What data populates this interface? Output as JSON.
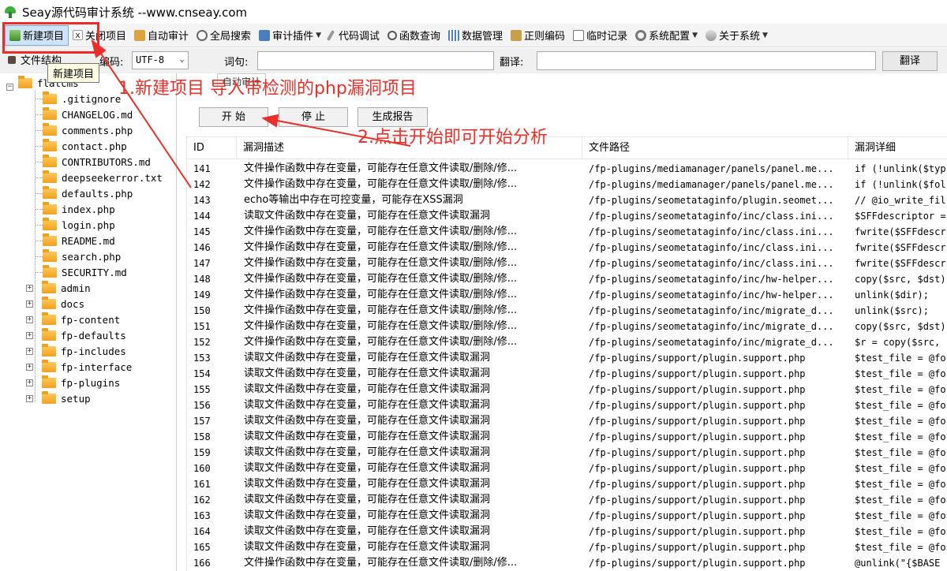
{
  "app": {
    "title": "Seay源代码审计系统  --www.cnseay.com"
  },
  "toolbar": {
    "items": [
      {
        "label": "新建项目",
        "icon": "new-project-icon"
      },
      {
        "label": "关闭项目",
        "icon": "close-project-icon"
      },
      {
        "label": "自动审计",
        "icon": "auto-audit-icon"
      },
      {
        "label": "全局搜索",
        "icon": "global-search-icon"
      },
      {
        "label": "审计插件",
        "icon": "audit-plugin-icon"
      },
      {
        "label": "代码调试",
        "icon": "code-debug-icon"
      },
      {
        "label": "函数查询",
        "icon": "function-query-icon"
      },
      {
        "label": "数据管理",
        "icon": "data-manage-icon"
      },
      {
        "label": "正则编码",
        "icon": "regex-encode-icon"
      },
      {
        "label": "临时记录",
        "icon": "temp-record-icon"
      },
      {
        "label": "系统配置",
        "icon": "system-config-icon"
      },
      {
        "label": "关于系统",
        "icon": "about-system-icon"
      }
    ]
  },
  "row2": {
    "file_tab": "文件结构",
    "encoding_label": "编码:",
    "encoding_value": "UTF-8",
    "word_label": "词句:",
    "translate_label": "翻译:",
    "translate_button": "翻译"
  },
  "tooltip": "新建项目",
  "tree": {
    "root": "flatcms",
    "files": [
      ".gitignore",
      "CHANGELOG.md",
      "comments.php",
      "contact.php",
      "CONTRIBUTORS.md",
      "deepseekerror.txt",
      "defaults.php",
      "index.php",
      "login.php",
      "README.md",
      "search.php",
      "SECURITY.md"
    ],
    "folders": [
      "admin",
      "docs",
      "fp-content",
      "fp-defaults",
      "fp-includes",
      "fp-interface",
      "fp-plugins",
      "setup"
    ]
  },
  "tabs": {
    "audit": "自动审计"
  },
  "buttons": {
    "start": "开 始",
    "stop": "停 止",
    "report": "生成报告"
  },
  "table": {
    "headers": [
      "ID",
      "漏洞描述",
      "文件路径",
      "漏洞详细"
    ],
    "rows": [
      [
        "141",
        "文件操作函数中存在变量，可能存在任意文件读取/删除/修...",
        "/fp-plugins/mediamanager/panels/panel.me...",
        "if (!unlink($typ"
      ],
      [
        "142",
        "文件操作函数中存在变量，可能存在任意文件读取/删除/修...",
        "/fp-plugins/mediamanager/panels/panel.me...",
        "if (!unlink($fol"
      ],
      [
        "143",
        "echo等输出中存在可控变量，可能存在XSS漏洞",
        "/fp-plugins/seometataginfo/plugin.seomet...",
        "// @io_write_fil"
      ],
      [
        "144",
        "读取文件函数中存在变量，可能存在任意文件读取漏洞",
        "/fp-plugins/seometataginfo/inc/class.ini...",
        "$SFFdescriptor ="
      ],
      [
        "145",
        "文件操作函数中存在变量，可能存在任意文件读取/删除/修...",
        "/fp-plugins/seometataginfo/inc/class.ini...",
        "fwrite($SFFdescr"
      ],
      [
        "146",
        "文件操作函数中存在变量，可能存在任意文件读取/删除/修...",
        "/fp-plugins/seometataginfo/inc/class.ini...",
        "fwrite($SFFdescr"
      ],
      [
        "147",
        "文件操作函数中存在变量，可能存在任意文件读取/删除/修...",
        "/fp-plugins/seometataginfo/inc/class.ini...",
        "fwrite($SFFdescr"
      ],
      [
        "148",
        "文件操作函数中存在变量，可能存在任意文件读取/删除/修...",
        "/fp-plugins/seometataginfo/inc/hw-helper...",
        "copy($src, $dst)"
      ],
      [
        "149",
        "文件操作函数中存在变量，可能存在任意文件读取/删除/修...",
        "/fp-plugins/seometataginfo/inc/hw-helper...",
        "unlink($dir);"
      ],
      [
        "150",
        "文件操作函数中存在变量，可能存在任意文件读取/删除/修...",
        "/fp-plugins/seometataginfo/inc/migrate_d...",
        "unlink($src);"
      ],
      [
        "151",
        "文件操作函数中存在变量，可能存在任意文件读取/删除/修...",
        "/fp-plugins/seometataginfo/inc/migrate_d...",
        "copy($src, $dst)"
      ],
      [
        "152",
        "文件操作函数中存在变量，可能存在任意文件读取/删除/修...",
        "/fp-plugins/seometataginfo/inc/migrate_d...",
        "$r = copy($src,"
      ],
      [
        "153",
        "读取文件函数中存在变量，可能存在任意文件读取漏洞",
        "/fp-plugins/support/plugin.support.php",
        "$test_file = @fo"
      ],
      [
        "154",
        "读取文件函数中存在变量，可能存在任意文件读取漏洞",
        "/fp-plugins/support/plugin.support.php",
        "$test_file = @fo"
      ],
      [
        "155",
        "读取文件函数中存在变量，可能存在任意文件读取漏洞",
        "/fp-plugins/support/plugin.support.php",
        "$test_file = @fo"
      ],
      [
        "156",
        "读取文件函数中存在变量，可能存在任意文件读取漏洞",
        "/fp-plugins/support/plugin.support.php",
        "$test_file = @fo"
      ],
      [
        "157",
        "读取文件函数中存在变量，可能存在任意文件读取漏洞",
        "/fp-plugins/support/plugin.support.php",
        "$test_file = @fo"
      ],
      [
        "158",
        "读取文件函数中存在变量，可能存在任意文件读取漏洞",
        "/fp-plugins/support/plugin.support.php",
        "$test_file = @fo"
      ],
      [
        "159",
        "读取文件函数中存在变量，可能存在任意文件读取漏洞",
        "/fp-plugins/support/plugin.support.php",
        "$test_file = @fo"
      ],
      [
        "160",
        "读取文件函数中存在变量，可能存在任意文件读取漏洞",
        "/fp-plugins/support/plugin.support.php",
        "$test_file = @fo"
      ],
      [
        "161",
        "读取文件函数中存在变量，可能存在任意文件读取漏洞",
        "/fp-plugins/support/plugin.support.php",
        "$test_file = @fo"
      ],
      [
        "162",
        "读取文件函数中存在变量，可能存在任意文件读取漏洞",
        "/fp-plugins/support/plugin.support.php",
        "$test_file = @fo"
      ],
      [
        "163",
        "读取文件函数中存在变量，可能存在任意文件读取漏洞",
        "/fp-plugins/support/plugin.support.php",
        "$test_file = @fo"
      ],
      [
        "164",
        "读取文件函数中存在变量，可能存在任意文件读取漏洞",
        "/fp-plugins/support/plugin.support.php",
        "$test_file = @fo"
      ],
      [
        "165",
        "读取文件函数中存在变量，可能存在任意文件读取漏洞",
        "/fp-plugins/support/plugin.support.php",
        "$test_file = @fo"
      ],
      [
        "166",
        "文件操作函数中存在变量，可能存在任意文件读取/删除/修...",
        "/fp-plugins/support/plugin.support.php",
        "@unlink(\"{$BASE"
      ]
    ]
  },
  "annotations": {
    "step1": "1.新建项目  导入带检测的php漏洞项目",
    "step2": "2.点击开始即可开始分析",
    "color": "#e8302b"
  }
}
